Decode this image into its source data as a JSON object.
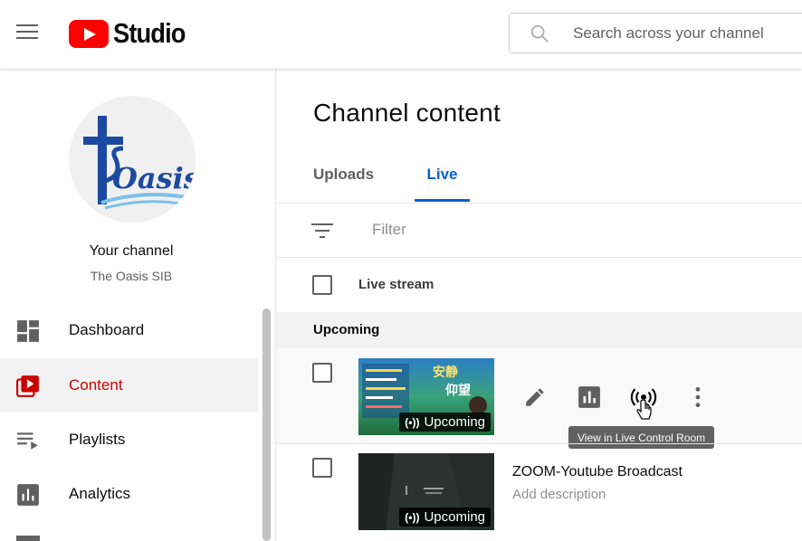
{
  "header": {
    "logo_text": "Studio",
    "search_placeholder": "Search across your channel"
  },
  "sidebar": {
    "channel_label": "Your channel",
    "channel_name": "The Oasis SIB",
    "avatar_text": "Oasis",
    "items": [
      {
        "label": "Dashboard",
        "icon": "dashboard-icon",
        "active": false
      },
      {
        "label": "Content",
        "icon": "content-icon",
        "active": true
      },
      {
        "label": "Playlists",
        "icon": "playlists-icon",
        "active": false
      },
      {
        "label": "Analytics",
        "icon": "analytics-icon",
        "active": false
      }
    ]
  },
  "main": {
    "title": "Channel content",
    "tabs": [
      {
        "label": "Uploads",
        "active": false
      },
      {
        "label": "Live",
        "active": true
      }
    ],
    "filter_placeholder": "Filter",
    "column_header": "Live stream",
    "section_label": "Upcoming",
    "rows": [
      {
        "title": "",
        "description": "",
        "badge": "Upcoming",
        "thumb_text_1": "安静",
        "thumb_text_2": "仰望"
      },
      {
        "title": "ZOOM-Youtube Broadcast",
        "description": "Add description",
        "badge": "Upcoming"
      }
    ],
    "tooltip": "View in Live Control Room"
  },
  "colors": {
    "brand_red": "#ff0000",
    "active_red": "#cc0000",
    "tab_blue": "#065fd4",
    "tooltip_bg": "#616161"
  }
}
